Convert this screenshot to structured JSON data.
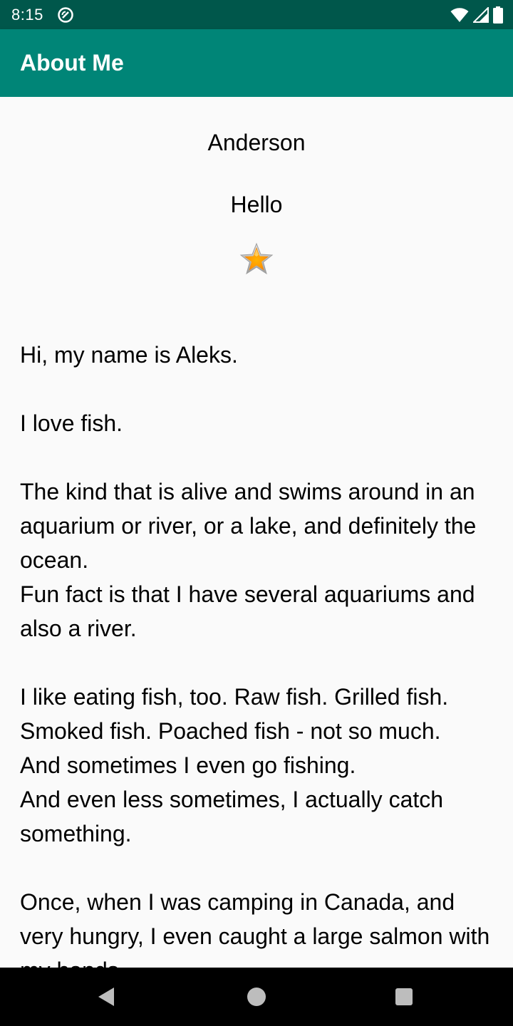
{
  "status_bar": {
    "time": "8:15",
    "icons": [
      "notification-sync-icon",
      "wifi-icon",
      "signal-icon",
      "battery-icon"
    ]
  },
  "app_bar": {
    "title": "About Me",
    "color": "#008577"
  },
  "profile": {
    "name": "Anderson",
    "nickname": "Hello",
    "star_icon": "star-icon"
  },
  "bio": {
    "text": "Hi, my name is Aleks.\n\nI love fish.\n\nThe kind that is alive and swims around in an aquarium or river, or a lake, and definitely the ocean.\nFun fact is that I have several aquariums and also a river.\n\nI like eating fish, too. Raw fish. Grilled fish. Smoked fish. Poached fish - not so much.\nAnd sometimes I even go fishing.\nAnd even less sometimes, I actually catch something.\n\nOnce, when I was camping in Canada, and very hungry, I even caught a large salmon with my hands."
  },
  "nav_bar": {
    "icons": [
      "back-icon",
      "home-icon",
      "recents-icon"
    ]
  },
  "colors": {
    "status_bar": "#00574b",
    "background": "#fafafa"
  }
}
